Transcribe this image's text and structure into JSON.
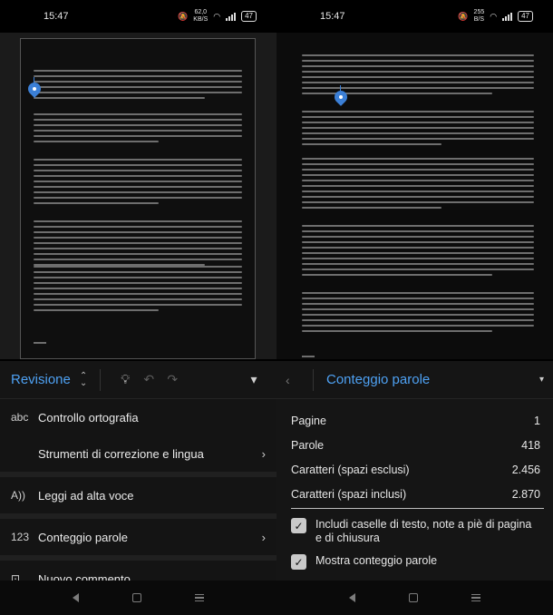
{
  "left": {
    "status": {
      "time": "15:47",
      "speed_value": "62,0",
      "speed_unit": "KB/S",
      "battery": "47"
    },
    "panel": {
      "title": "Revisione",
      "items": [
        {
          "icon": "abc",
          "label": "Controllo ortografia"
        },
        {
          "label": "Strumenti di correzione e lingua"
        },
        {
          "label": "Leggi ad alta voce"
        },
        {
          "icon": "123",
          "label": "Conteggio parole"
        },
        {
          "label": "Nuovo commento"
        }
      ]
    }
  },
  "right": {
    "status": {
      "time": "15:47",
      "speed_value": "255",
      "speed_unit": "B/S",
      "battery": "47"
    },
    "panel": {
      "title": "Conteggio parole",
      "stats": [
        {
          "label": "Pagine",
          "value": "1"
        },
        {
          "label": "Parole",
          "value": "418"
        },
        {
          "label": "Caratteri (spazi esclusi)",
          "value": "2.456"
        },
        {
          "label": "Caratteri (spazi inclusi)",
          "value": "2.870"
        }
      ],
      "options": [
        {
          "label": "Includi caselle di testo, note a piè di pagina e di chiusura",
          "checked": true
        },
        {
          "label": "Mostra conteggio parole",
          "checked": true
        }
      ]
    }
  }
}
